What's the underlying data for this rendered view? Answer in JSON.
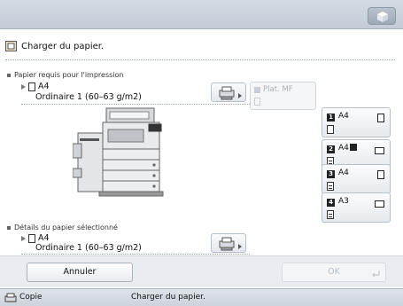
{
  "header": {
    "icon": "settings-cube-icon"
  },
  "instruction": {
    "text": "Charger du papier.",
    "icon": "paper-load-icon"
  },
  "required": {
    "title": "Papier requis pour l'impression",
    "size": "A4",
    "type": "Ordinaire 1 (60–63 g/m2)"
  },
  "manual_feed": {
    "label": "Plat. MF"
  },
  "drawers": [
    {
      "num": "1",
      "size": "A4",
      "orientation": "portrait",
      "stack": "empty"
    },
    {
      "num": "2",
      "size": "A4",
      "badge": true,
      "orientation": "landscape",
      "stack": "full"
    },
    {
      "num": "3",
      "size": "A4",
      "orientation": "portrait",
      "stack": "full"
    },
    {
      "num": "4",
      "size": "A3",
      "orientation": "landscape",
      "stack": "full"
    }
  ],
  "selected": {
    "title": "Détails du papier sélectionné",
    "size": "A4",
    "type": "Ordinaire 1 (60–63 g/m2)"
  },
  "buttons": {
    "cancel": "Annuler",
    "ok": "OK"
  },
  "status": {
    "app": "Copie",
    "message": "Charger du papier."
  }
}
